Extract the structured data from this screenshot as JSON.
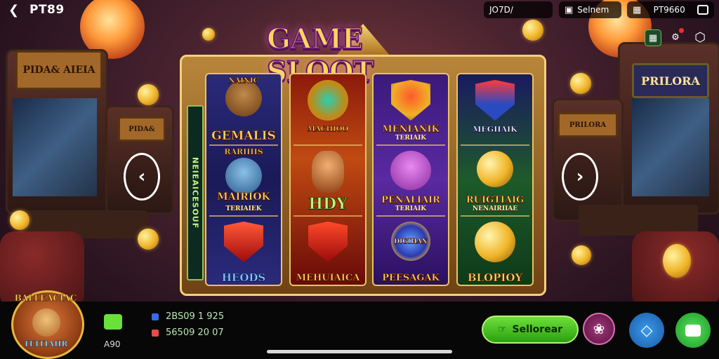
{
  "header": {
    "back_icon": "arrow-left-icon",
    "brand": "PT89",
    "pills": [
      {
        "text": "JO7D/"
      },
      {
        "icon": "gift-icon",
        "text": "Selnem"
      },
      {
        "icon": "chest-icon",
        "text": "PT9660",
        "end_icon": "wallet-icon"
      }
    ],
    "icons": [
      "settings-cube-icon",
      "gear-icon",
      "hexagon-icon"
    ]
  },
  "background": {
    "left_sign": "PIDA& AIEIA",
    "left_small_sign": "PIDA&",
    "right_sign": "PRILORA",
    "right_small_sign": "PRILORA"
  },
  "game": {
    "title": "GAME SLOOT",
    "side_rail": "NEIEAICESOUF",
    "reels": [
      [
        {
          "label": "GEMALIS",
          "sub": "",
          "top": "NAINIC",
          "icon": "wolf-icon",
          "color": "#8a5a2a"
        },
        {
          "label": "MAIRIOK",
          "sub": "TERIAIEK",
          "top": "RARIIIIS",
          "icon": "warrior-woman-icon",
          "color": "#3a7ab8"
        },
        {
          "label": "HEODS",
          "sub": "",
          "icon": "red-gem-icon",
          "color": "#c01a1a"
        }
      ],
      [
        {
          "label": "",
          "sub": "",
          "top": "MACHIOO",
          "icon": "golden-mask-icon",
          "color": "#2a8a7a"
        },
        {
          "label": "HDY",
          "sub": "",
          "icon": "warrior-hero-icon",
          "color": "#c07a3a"
        },
        {
          "label": "MEHUIAICA",
          "sub": "",
          "icon": "red-shield-icon",
          "color": "#c01a1a"
        }
      ],
      [
        {
          "label": "MENIANIK",
          "sub": "TERIAIK",
          "icon": "golden-shield-icon",
          "color": "#e0a020"
        },
        {
          "label": "PENALIAIR",
          "sub": "TERIAIK",
          "icon": "purple-cat-icon",
          "color": "#c04ad0"
        },
        {
          "label": "PEESAGAK",
          "sub": "",
          "top": "DIGIHAN",
          "icon": "blue-coin-icon",
          "color": "#3a6ae0"
        }
      ],
      [
        {
          "label": "",
          "sub": "",
          "top": "MEGIIAIK",
          "icon": "blue-shield-icon",
          "color": "#2a5ac0"
        },
        {
          "label": "RUIGTIAIG",
          "sub": "NENAIRIIAE",
          "icon": "golden-orb-icon",
          "color": "#e0b020"
        },
        {
          "label": "BLOPIOY",
          "sub": "",
          "icon": "gold-coin-icon",
          "color": "#e0b020"
        }
      ]
    ],
    "prev_icon": "chevron-left-icon",
    "next_icon": "chevron-right-icon"
  },
  "footer": {
    "avatar_top": "BALLEACIAC",
    "avatar_bottom": "TEITIAIIR",
    "player_icon": "robot-icon",
    "player_value": "A90",
    "stats": [
      {
        "icon": "blue-square-icon",
        "color": "#3a6ae8",
        "text": "2BS09 1 925"
      },
      {
        "icon": "red-square-icon",
        "color": "#e84a4a",
        "text": "56509 20 07"
      }
    ],
    "spin_button": {
      "icon": "hand-icon",
      "label": "Sellorear"
    },
    "buttons": [
      "gear-flower-icon",
      "diamond-outline-icon",
      "chat-icon"
    ]
  }
}
